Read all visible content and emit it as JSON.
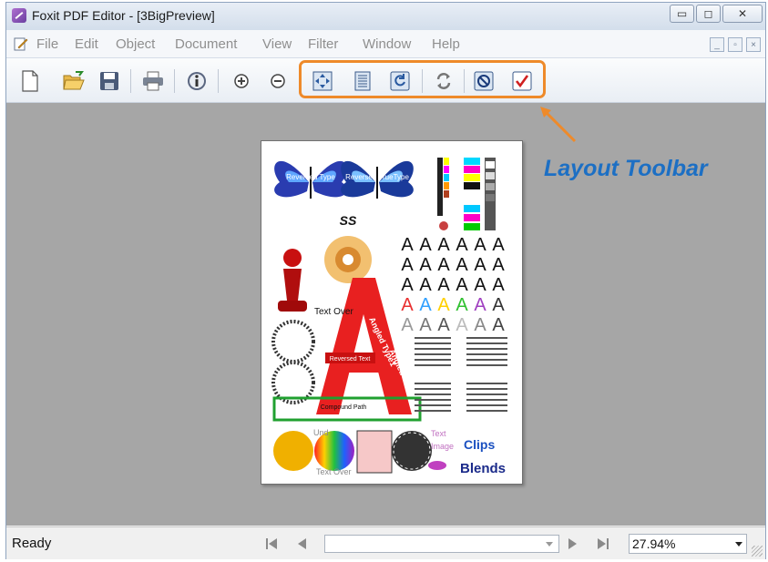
{
  "window": {
    "title": "Foxit PDF Editor - [3BigPreview]"
  },
  "window_controls": {
    "minimize": "▭",
    "maximize": "◻",
    "close": "✕"
  },
  "menu": {
    "items": [
      "File",
      "Edit",
      "Object",
      "Document",
      "View",
      "Filter",
      "Window",
      "Help"
    ]
  },
  "mdi_controls": {
    "minimize": "_",
    "restore": "▫",
    "close": "×"
  },
  "toolbar": {
    "buttons": [
      "new-file-icon",
      "open-folder-icon",
      "save-icon",
      "print-icon",
      "info-icon",
      "zoom-in-icon",
      "zoom-out-icon",
      "fit-page-icon",
      "fit-width-icon",
      "rotate-icon",
      "refresh-icon",
      "stop-icon",
      "checkmark-icon"
    ]
  },
  "annotation": {
    "label": "Layout Toolbar"
  },
  "statusbar": {
    "status": "Ready",
    "zoom": "27.94%"
  },
  "page_preview": {
    "texts": {
      "reversed_type": "Reversed Type",
      "reversed_truetype": "Reversed TrueType",
      "ss": "SS",
      "angled_type1": "Angled Type1",
      "angled_truetype": "Angled TrueType",
      "text_over": "Text Over",
      "reversed_text": "Reversed Text",
      "compound_path": "Compound Path",
      "text": "Text",
      "image": "Image",
      "clips": "Clips",
      "blends": "Blends",
      "text_over2": "Text Over",
      "under": "Und"
    }
  }
}
